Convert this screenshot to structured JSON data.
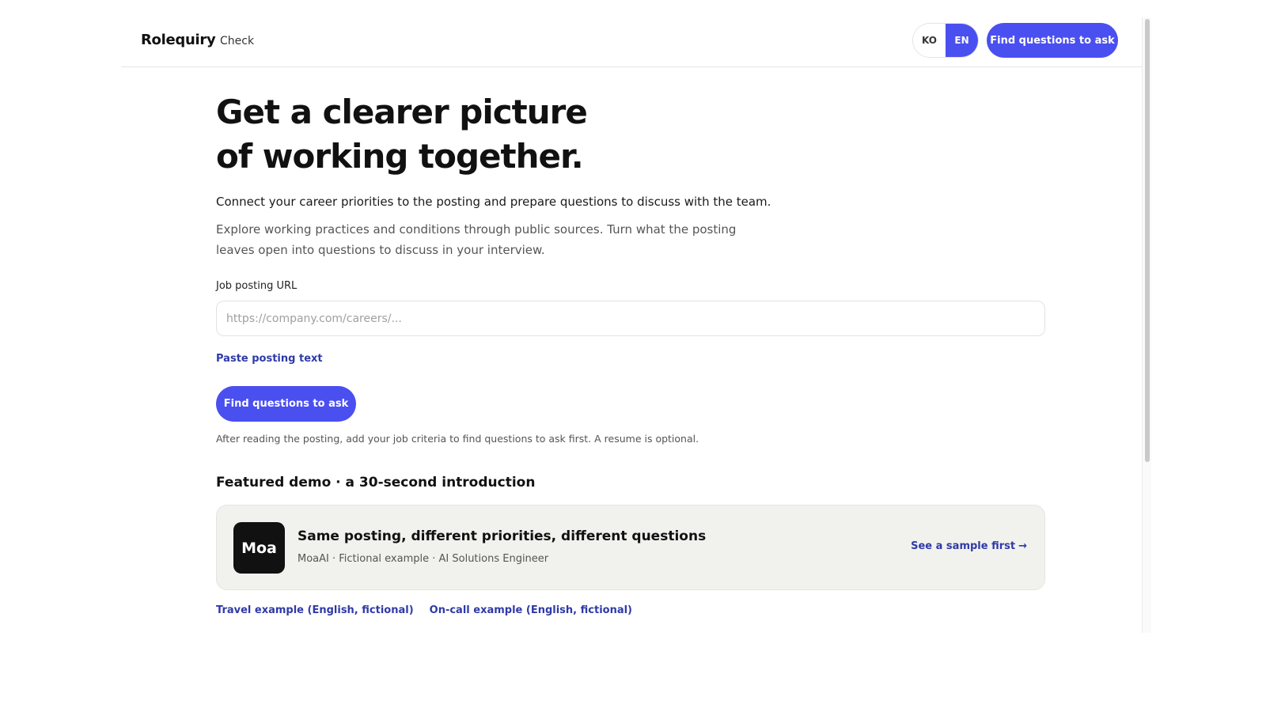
{
  "header": {
    "brand": "Rolequiry",
    "nav_check": "Check",
    "lang_ko": "KO",
    "lang_en": "EN",
    "lang_active": "EN",
    "cta_label": "Find questions to ask"
  },
  "hero": {
    "title_line1": "Get a clearer picture",
    "title_line2": "of working together.",
    "lead": "Connect your career priorities to the posting and prepare questions to discuss with the team.",
    "sub_line1": "Explore working practices and conditions through public sources. Turn what the posting",
    "sub_line2": "leaves open into questions to discuss in your interview."
  },
  "form": {
    "url_label": "Job posting URL",
    "url_value": "",
    "url_placeholder": "https://company.com/careers/...",
    "paste_link": "Paste posting text",
    "submit_label": "Find questions to ask",
    "helper": "After reading the posting, add your job criteria to find questions to ask first. A resume is optional."
  },
  "demo": {
    "heading": "Featured demo · a 30-second introduction",
    "logo_text": "Moa",
    "title": "Same posting, different priorities, different questions",
    "meta": "MoaAI · Fictional example · AI Solutions Engineer",
    "sample_link": "See a sample first",
    "sample_arrow": "→"
  },
  "examples": {
    "travel": "Travel example (English, fictional)",
    "oncall": "On-call example (English, fictional)"
  },
  "colors": {
    "accent": "#4a4ff0",
    "link": "#2f3aa8",
    "card_bg": "#f1f1ee",
    "logo_bg": "#111111"
  },
  "icons": {
    "sample_arrow": "arrow-right-icon"
  }
}
